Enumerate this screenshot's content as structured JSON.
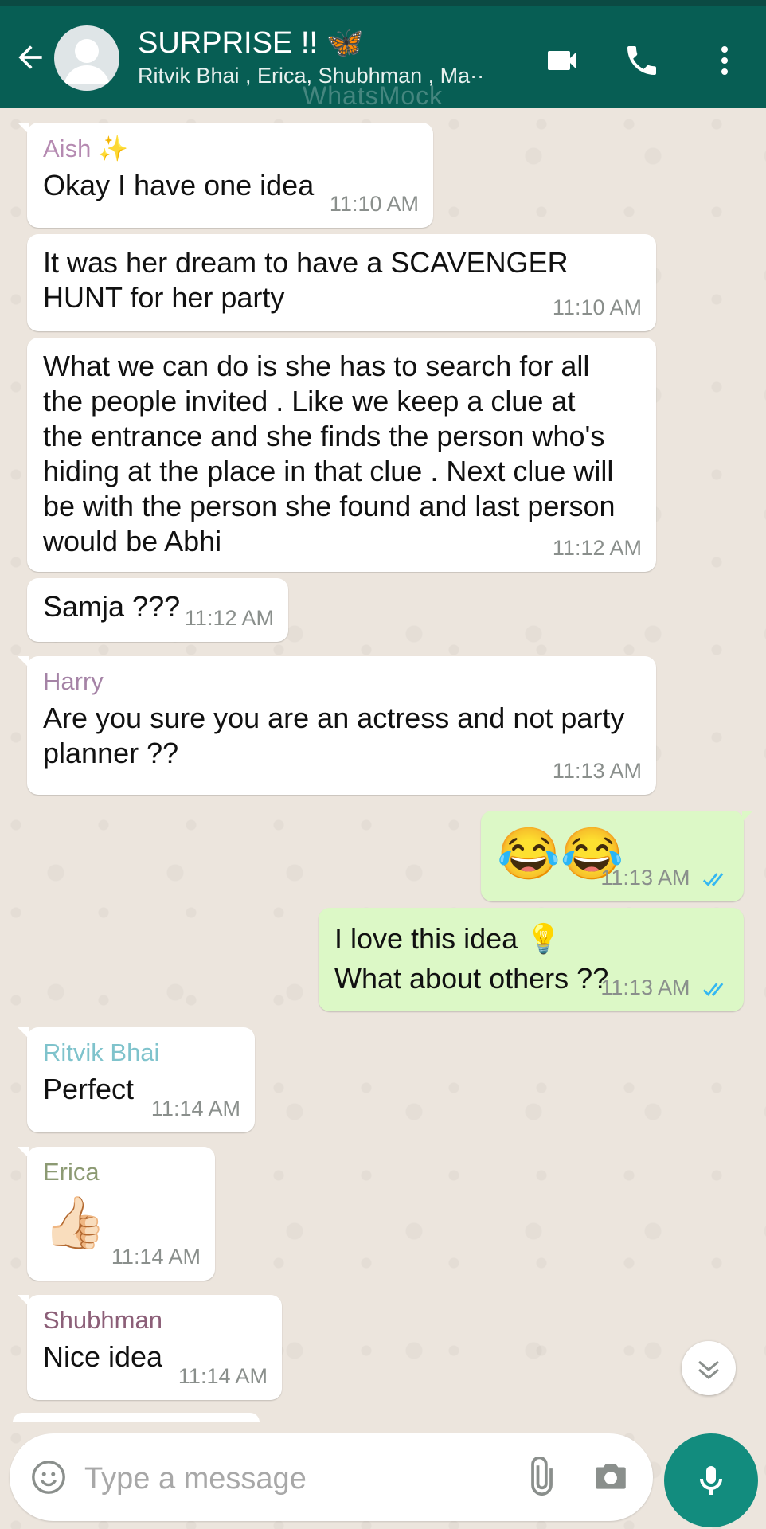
{
  "header": {
    "title": "SURPRISE !! 🦋",
    "subtitle": "Ritvik Bhai , Erica, Shubhman , Ma··",
    "watermark": "WhatsMock"
  },
  "colors": {
    "header_bg": "#075e54",
    "incoming_bg": "#ffffff",
    "outgoing_bg": "#dcf8c6",
    "read_tick": "#34b7f1",
    "mic_bg": "#128c7e"
  },
  "messages": [
    {
      "sender": "Aish ✨",
      "sender_color": "#b58ab1",
      "text": "Okay I have one idea",
      "time": "11:10 AM"
    },
    {
      "text": "It was her dream to have a SCAVENGER\nHUNT for her party",
      "time": "11:10 AM"
    },
    {
      "text": "What we can do is she has to search for all\nthe people invited . Like we keep a clue at\nthe entrance and she finds the person who's\nhiding at the place in that clue . Next clue will\nbe with the person she found and last person\nwould be Abhi",
      "time": "11:12 AM"
    },
    {
      "text": "Samja ???",
      "time": "11:12 AM"
    },
    {
      "sender": "Harry",
      "sender_color": "#a583a6",
      "text": "Are you sure you are an actress and not party\nplanner ??",
      "time": "11:13 AM"
    },
    {
      "text": "😂😂",
      "time": "11:13 AM",
      "outgoing": true
    },
    {
      "text": "I love this idea 💡\nWhat about others ??",
      "time": "11:13 AM",
      "outgoing": true
    },
    {
      "sender": "Ritvik Bhai",
      "sender_color": "#7fc3cc",
      "text": "Perfect",
      "time": "11:14 AM"
    },
    {
      "sender": "Erica",
      "sender_color": "#8c9a73",
      "text": "👍🏻",
      "time": "11:14 AM"
    },
    {
      "sender": "Shubhman",
      "sender_color": "#8c5f78",
      "text": "Nice idea",
      "time": "11:14 AM"
    }
  ],
  "composer": {
    "placeholder": "Type a message"
  },
  "icons": {
    "back": "arrow-left-icon",
    "video": "video-camera-icon",
    "call": "phone-icon",
    "menu": "more-vertical-icon",
    "emoji": "emoji-icon",
    "attach": "paperclip-icon",
    "camera": "camera-icon",
    "mic": "microphone-icon",
    "scroll": "chevron-double-down-icon",
    "read": "double-check-icon"
  }
}
